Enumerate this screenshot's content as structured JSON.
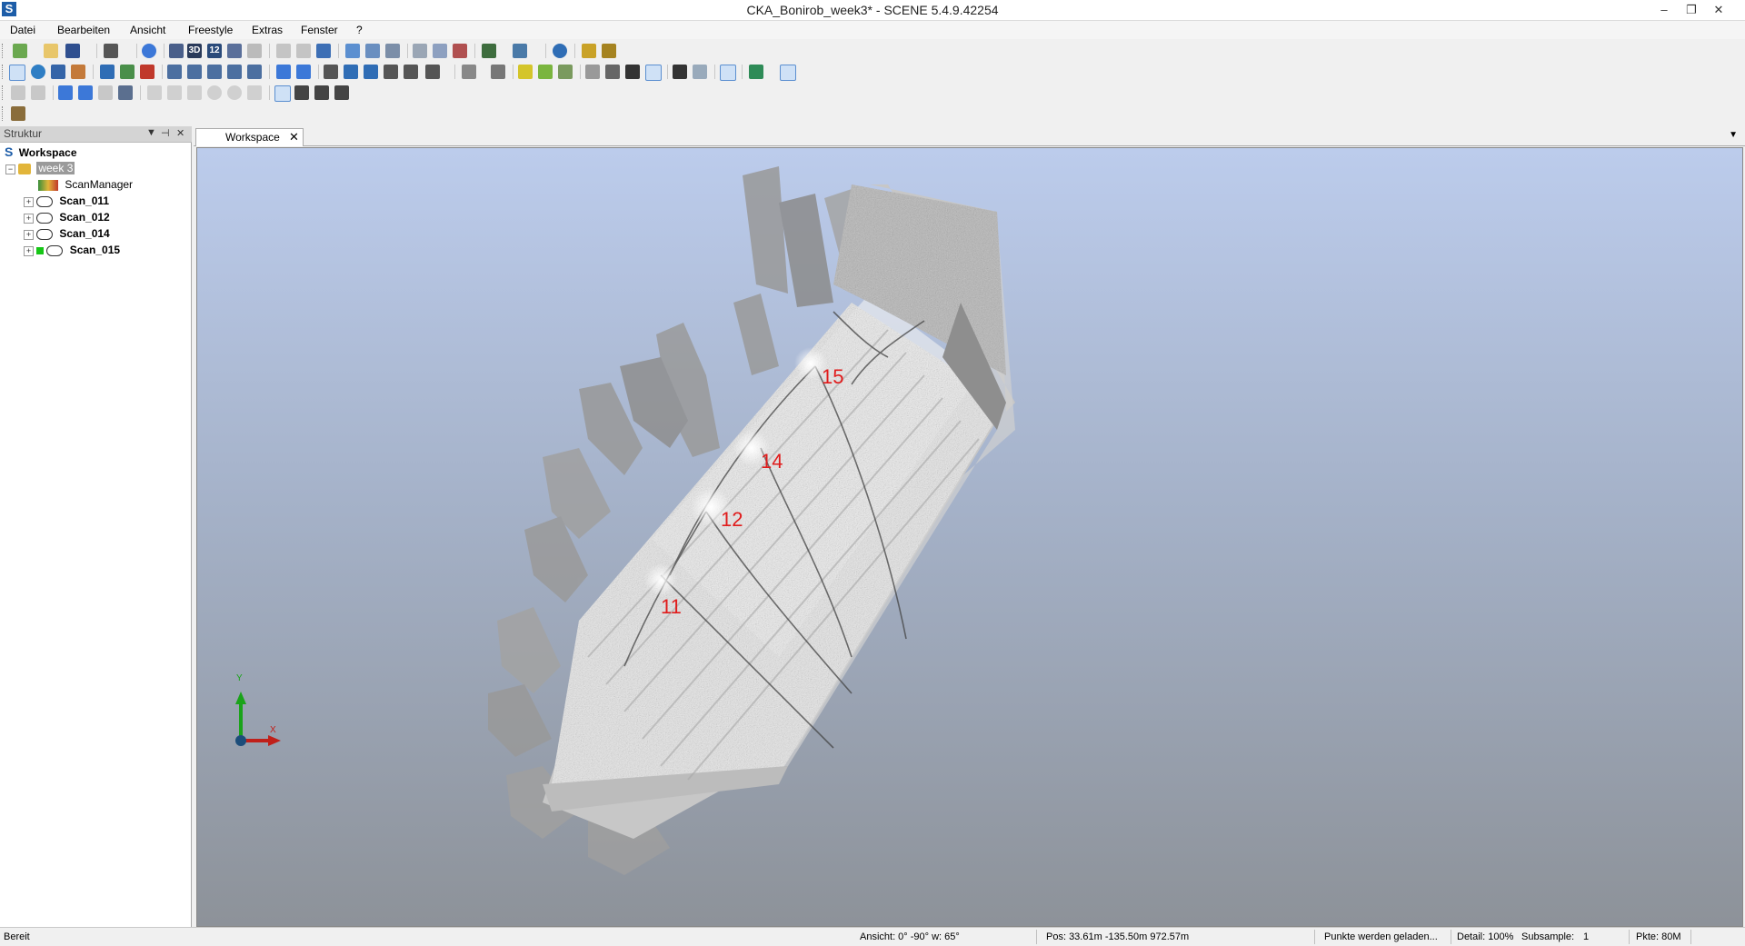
{
  "window": {
    "title": "CKA_Bonirob_week3* - SCENE 5.4.9.42254",
    "app_icon": "S",
    "minimize": "–",
    "restore": "❐"
  },
  "menu": [
    "Datei",
    "Bearbeiten",
    "Ansicht",
    "Freestyle",
    "Extras",
    "Fenster",
    "?"
  ],
  "menu_underline_first": [
    "D",
    "B",
    "A",
    "F",
    "E",
    "F",
    "?"
  ],
  "toolbar": {
    "btn_3d": "3D",
    "btn_12": "12"
  },
  "struktur": {
    "title": "Struktur",
    "tree": {
      "root": "Workspace",
      "project": "week 3",
      "items": [
        "ScanManager",
        "Scan_011",
        "Scan_012",
        "Scan_014",
        "Scan_015"
      ]
    }
  },
  "tabs": [
    {
      "label": "Workspace",
      "close": "✕"
    }
  ],
  "viewport": {
    "scan_labels": [
      "15",
      "14",
      "12",
      "11"
    ],
    "axis_x": "X",
    "axis_y": "Y",
    "background_top": "#bcccec",
    "background_bottom": "#8d9299"
  },
  "status": {
    "ready": "Bereit",
    "view": "Ansicht: 0° -90° w: 65°",
    "pos": "Pos: 33.61m -135.50m 972.57m",
    "loading": "Punkte werden geladen...",
    "detail": "Detail: 100%",
    "subsample_label": "Subsample:",
    "subsample_value": "1",
    "points": "Pkte: 80M"
  },
  "colors": {
    "label_red": "#e01b1b",
    "accent_blue": "#1d5da8",
    "scan_on_green": "#16c616"
  }
}
